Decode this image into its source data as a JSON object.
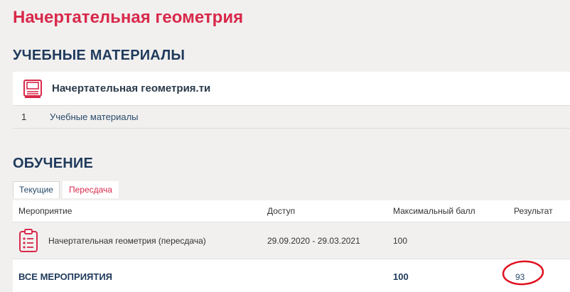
{
  "page": {
    "title": "Начертательная геометрия"
  },
  "materials": {
    "section_title": "УЧЕБНЫЕ МАТЕРИАЛЫ",
    "course_title": "Начертательная геометрия.ти",
    "icon": "book-icon",
    "items": [
      {
        "num": "1",
        "label": "Учебные материалы"
      }
    ]
  },
  "learning": {
    "section_title": "ОБУЧЕНИЕ",
    "tabs": [
      {
        "label": "Текущие",
        "active": true
      },
      {
        "label": "Пересдача",
        "active": false
      }
    ],
    "columns": [
      "Мероприятие",
      "Доступ",
      "Максимальный балл",
      "Результат"
    ],
    "rows": [
      {
        "icon": "clipboard-list-icon",
        "event": "Начертательная геометрия (пересдача)",
        "access": "29.09.2020 - 29.03.2021",
        "max_score": "100",
        "result": ""
      }
    ],
    "total": {
      "label": "ВСЕ МЕРОПРИЯТИЯ",
      "max_score": "100",
      "result": "93"
    }
  },
  "colors": {
    "accent": "#d8294a",
    "heading": "#1f3a5c",
    "link": "#2a4a6b",
    "annotation_circle": "#e0101e"
  }
}
